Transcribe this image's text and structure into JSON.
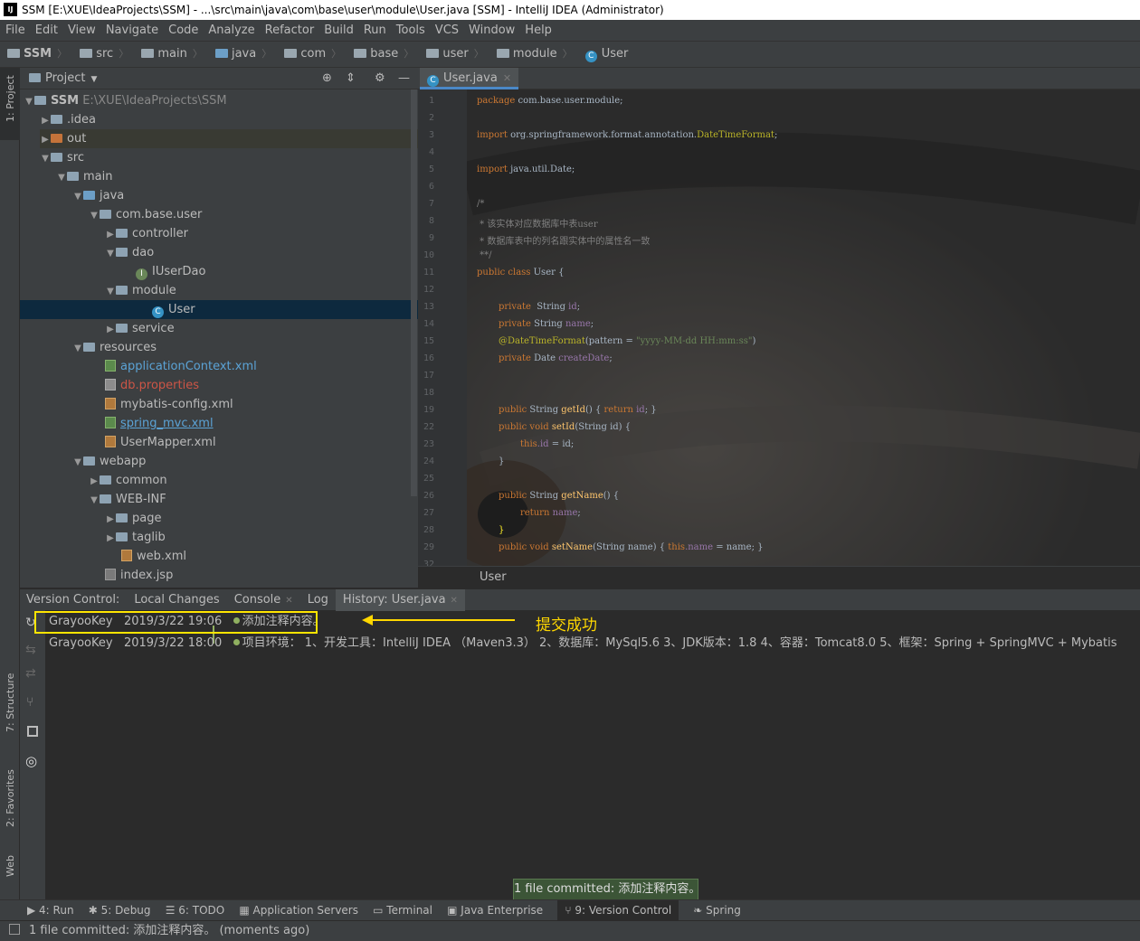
{
  "title_bar": {
    "app_icon": "IJ",
    "title": "SSM [E:\\XUE\\IdeaProjects\\SSM] - ...\\src\\main\\java\\com\\base\\user\\module\\User.java [SSM] - IntelliJ IDEA (Administrator)"
  },
  "menu": [
    "File",
    "Edit",
    "View",
    "Navigate",
    "Code",
    "Analyze",
    "Refactor",
    "Build",
    "Run",
    "Tools",
    "VCS",
    "Window",
    "Help"
  ],
  "breadcrumbs": [
    "SSM",
    "src",
    "main",
    "java",
    "com",
    "base",
    "user",
    "module",
    "User"
  ],
  "left_strip": {
    "project_tab": "1: Project",
    "structure_tab": "7: Structure",
    "favorites_tab": "2: Favorites",
    "web_tab": "Web"
  },
  "project_panel": {
    "title": "Project",
    "tree": [
      {
        "label": "SSM",
        "path": "E:\\XUE\\IdeaProjects\\SSM"
      },
      {
        "label": ".idea"
      },
      {
        "label": "out"
      },
      {
        "label": "src"
      },
      {
        "label": "main"
      },
      {
        "label": "java"
      },
      {
        "label": "com.base.user"
      },
      {
        "label": "controller"
      },
      {
        "label": "dao"
      },
      {
        "label": "IUserDao"
      },
      {
        "label": "module"
      },
      {
        "label": "User"
      },
      {
        "label": "service"
      },
      {
        "label": "resources"
      },
      {
        "label": "applicationContext.xml"
      },
      {
        "label": "db.properties"
      },
      {
        "label": "mybatis-config.xml"
      },
      {
        "label": "spring_mvc.xml"
      },
      {
        "label": "UserMapper.xml"
      },
      {
        "label": "webapp"
      },
      {
        "label": "common"
      },
      {
        "label": "WEB-INF"
      },
      {
        "label": "page"
      },
      {
        "label": "taglib"
      },
      {
        "label": "web.xml"
      },
      {
        "label": "index.jsp"
      }
    ]
  },
  "editor": {
    "tab": "User.java",
    "line_numbers": [
      "1",
      "2",
      "3",
      "4",
      "5",
      "6",
      "7",
      "8",
      "9",
      "10",
      "11",
      "12",
      "13",
      "14",
      "15",
      "16",
      "17",
      "18",
      "19",
      "22",
      "23",
      "24",
      "25",
      "26",
      "27",
      "28",
      "29",
      "32"
    ],
    "code": {
      "l1_kw": "package",
      "l1_rest": " com.base.user.module;",
      "l3_kw": "import",
      "l3_rest": " org.springframework.format.annotation.",
      "l3_cls": "DateTimeFormat",
      "l3_end": ";",
      "l5_kw": "import",
      "l5_rest": " java.util.Date;",
      "l7": "/*",
      "l8": " * 该实体对应数据库中表user",
      "l9": " * 数据库表中的列名跟实体中的属性名一致",
      "l10": " **/",
      "l11_kw": "public class",
      "l11_rest": " User {",
      "l13_kw": "private",
      "l13_type": "  String ",
      "l13_fd": "id",
      "l14_kw": "private",
      "l14_type": " String ",
      "l14_fd": "name",
      "l15_an": "@DateTimeFormat",
      "l15_p": "(pattern = ",
      "l15_st": "\"yyyy-MM-dd HH:mm:ss\"",
      "l15_end": ")",
      "l16_kw": "private",
      "l16_type": " Date ",
      "l16_fd": "createDate",
      "l19_kw": "public",
      "l19_type": " String ",
      "l19_fn": "getId",
      "l19_body": "() { ",
      "l19_ret": "return",
      "l19_fd": " id",
      "l19_end": "; }",
      "l22_kw": "public void",
      "l22_fn": " setId",
      "l22_rest": "(String id) {",
      "l23_kw": "this",
      "l23_fd": ".id",
      "l23_rest": " = id;",
      "l24": "}",
      "l26_kw": "public",
      "l26_type": " String ",
      "l26_fn": "getName",
      "l26_rest": "() {",
      "l27_kw": "return",
      "l27_fd": " name",
      "l27_end": ";",
      "l28": "}",
      "l29_kw": "public void",
      "l29_fn": " setName",
      "l29_rest": "(String name) { ",
      "l29_this": "this",
      "l29_fd": ".name",
      "l29_end": " = name; }"
    },
    "breadcrumb": "User"
  },
  "version_control": {
    "tabs": [
      "Version Control:",
      "Local Changes",
      "Console",
      "Log",
      "History: User.java"
    ],
    "commits": [
      {
        "author": "GrayooKey",
        "date": "2019/3/22 19:06",
        "message": "添加注释内容。"
      },
      {
        "author": "GrayooKey",
        "date": "2019/3/22 18:00",
        "message": "项目环境： 1、开发工具：IntelliJ IDEA （Maven3.3） 2、数据库：MySql5.6 3、JDK版本：1.8 4、容器：Tomcat8.0 5、框架：Spring + SpringMVC + Mybatis"
      }
    ],
    "annotation": "提交成功"
  },
  "balloon": "1 file committed: 添加注释内容。",
  "tool_windows": [
    "4: Run",
    "5: Debug",
    "6: TODO",
    "Application Servers",
    "Terminal",
    "Java Enterprise",
    "9: Version Control",
    "Spring"
  ],
  "status_bar": "1 file committed: 添加注释内容。 (moments ago)",
  "colors": {
    "keyword": "#cc7832",
    "comment": "#808080",
    "annotation": "#bbb529",
    "highlight": "#ffe500",
    "selection": "#0d293e"
  }
}
